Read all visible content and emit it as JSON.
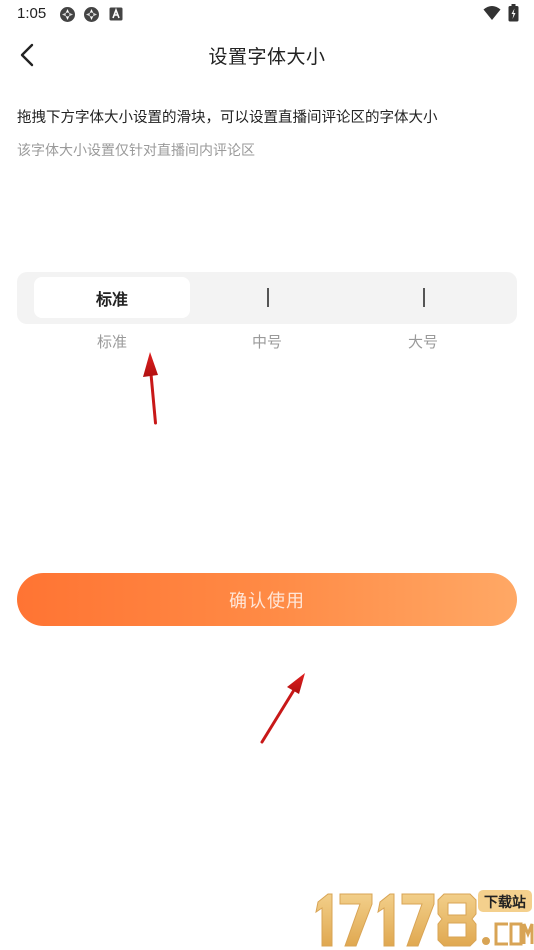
{
  "status_bar": {
    "time": "1:05"
  },
  "header": {
    "title": "设置字体大小"
  },
  "description": {
    "primary": "拖拽下方字体大小设置的滑块，可以设置直播间评论区的字体大小",
    "secondary": "该字体大小设置仅针对直播间内评论区"
  },
  "slider": {
    "selected_label": "标准",
    "options": [
      "标准",
      "中号",
      "大号"
    ],
    "selected_index": 0
  },
  "confirm_button": {
    "label": "确认使用"
  },
  "watermark": {
    "digits": "17178",
    "badge": "下载站",
    "domain": ".COM"
  },
  "colors": {
    "accent_start": "#ff7433",
    "accent_end": "#ffa865",
    "annotation_arrow": "#d41e1e"
  }
}
